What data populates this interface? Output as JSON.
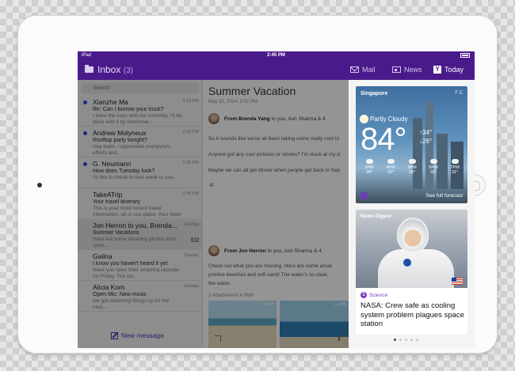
{
  "status": {
    "carrier": "iPad",
    "time": "2:45 PM"
  },
  "nav": {
    "inbox_title": "Inbox",
    "inbox_count": "(3)",
    "mail": "Mail",
    "news": "News",
    "today": "Today",
    "today_icon_letter": "Y"
  },
  "search": {
    "placeholder": "Search"
  },
  "messages": [
    {
      "sender": "Xianzhe Ma",
      "subject": "Re: Can I borrow your truck?",
      "preview": "I have the keys with me currently. I'll be done with it by tomorrow...",
      "time": "2:12 PM",
      "unread": true
    },
    {
      "sender": "Andrew Molyneux",
      "subject": "Rooftop party tonight?",
      "preview": "Hey team, I appreciate everyone's efforts and...",
      "time": "2:15 PM",
      "unread": true
    },
    {
      "sender": "G. Neumann",
      "subject": "How does Tuesday look?",
      "preview": "I'd like to check in next week to see...",
      "time": "2:35 PM",
      "unread": true
    },
    {
      "sender": "TakeATrip",
      "subject": "Your travel itinerary",
      "preview": "This is your most recent travel information, all in one place. Your hotel reserv...",
      "time": "2:35 PM",
      "unread": false
    },
    {
      "sender": "Jon Herron to you, Brenda...",
      "subject": "Summer Vacations",
      "preview": "Here are some amazing photos from sprin...",
      "time": "Sunday",
      "badge": "13",
      "unread": false
    },
    {
      "sender": "Galina",
      "subject": "I know you haven't heard it yet",
      "preview": "Have you seen their amazing episode on Friday. The clo...",
      "time": "Sunday",
      "unread": false
    },
    {
      "sender": "Alicia Korn",
      "subject": "Open Mic: New music",
      "preview": "Ive got switching things up for the next...",
      "time": "Sunday",
      "unread": false
    }
  ],
  "new_message": "New message",
  "reader": {
    "title": "Summer Vacation",
    "date": "May 25, 2014, 8:02 PM",
    "from1_name": "From Brenda Yang",
    "from1_rest": " to you, Ash Sharma & 4",
    "body1": [
      "So it sounds like we've all been taking some really cool tri",
      "Anyone got any cool pictures or stories? I'm stuck at my d",
      "Maybe we can all get dinner when people get back in Sep",
      "-B"
    ],
    "from2_name": "From Jon Herron",
    "from2_rest": " to you, Ash Sharma & 4",
    "body2": [
      "Check out what you are missing. Here are some amaz",
      "pristine beaches and soft sand! The water's so clear,",
      "the water."
    ],
    "attachments": "2 Attachments 4.0MB",
    "thumb1_size": "2.0MB",
    "thumb2_size": "1.2MB"
  },
  "weather": {
    "city": "Singapore",
    "units": "F  C",
    "condition": "Partly Cloudy",
    "temp": "84°",
    "hi": "↑34°",
    "lo": "↓26°",
    "forecast": [
      {
        "time": "3PM",
        "temp": "34°"
      },
      {
        "time": "4PM",
        "temp": "33°"
      },
      {
        "time": "5PM",
        "temp": "33°"
      },
      {
        "time": "6PM",
        "temp": "32°"
      },
      {
        "time": "7PM",
        "temp": "31°"
      }
    ],
    "link": "See full forecast"
  },
  "news": {
    "label": "News Digest",
    "category": "Science",
    "headline": "NASA: Crew safe as cooling system problem plagues space station"
  },
  "colors": {
    "brand_purple": "#4a1a8a",
    "unread_blue": "#2f4fd6",
    "science_purple": "#7a3fc6"
  }
}
